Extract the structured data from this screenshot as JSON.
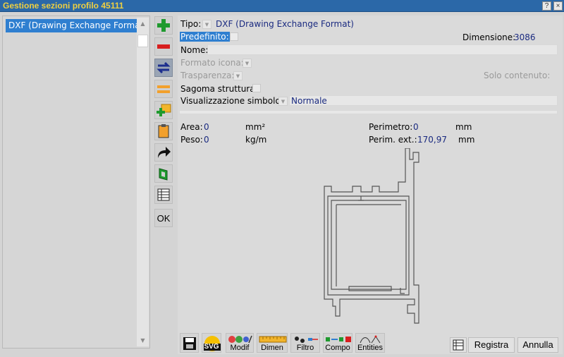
{
  "window": {
    "title": "Gestione sezioni profilo 45111",
    "help_label": "?",
    "close_label": "×"
  },
  "left_list": {
    "items": [
      "DXF (Drawing Exchange Format)"
    ]
  },
  "toolstrip": {
    "icons": [
      "add-icon",
      "remove-icon",
      "swap-icon",
      "equal-icon",
      "add-folder-icon",
      "clipboard-icon",
      "forward-arrow-icon",
      "profile-section-icon",
      "grid-icon"
    ],
    "ok_label": "OK"
  },
  "form": {
    "tipo_label": "Tipo:",
    "tipo_value": "DXF (Drawing Exchange Format)",
    "predefinito_label": "Predefinito:",
    "dimensione_label": "Dimensione:",
    "dimensione_value": "3086",
    "nome_label": "Nome:",
    "nome_value": "",
    "formato_icona_label": "Formato icona:",
    "trasparenza_label": "Trasparenza:",
    "solo_contenuto_label": "Solo contenuto:",
    "sagoma_label": "Sagoma struttura:",
    "visualizzazione_label": "Visualizzazione simbolo:",
    "visualizzazione_value": "Normale"
  },
  "metrics": {
    "area_label": "Area:",
    "area_value": "0",
    "area_unit": "mm²",
    "peso_label": "Peso:",
    "peso_value": "0",
    "peso_unit": "kg/m",
    "perimetro_label": "Perimetro:",
    "perimetro_value": "0",
    "perimetro_unit": "mm",
    "perim_ext_label": "Perim. ext.:",
    "perim_ext_value": "170,97",
    "perim_ext_unit": "mm"
  },
  "bottom_toolbar": {
    "buttons": [
      {
        "label": "",
        "icon": "save-icon"
      },
      {
        "label": "SVG",
        "icon": "svg-icon"
      },
      {
        "label": "Modif",
        "icon": "modify-icon"
      },
      {
        "label": "Dimen",
        "icon": "ruler-icon"
      },
      {
        "label": "Filtro",
        "icon": "filter-icon"
      },
      {
        "label": "Compo",
        "icon": "components-icon"
      },
      {
        "label": "Entities",
        "icon": "entities-icon"
      }
    ],
    "registra_label": "Registra",
    "annulla_label": "Annulla"
  },
  "colors": {
    "titlebar": "#2b68a8",
    "title_text": "#f0d040",
    "selection": "#2f7fd0",
    "value_text": "#1a2a80"
  }
}
